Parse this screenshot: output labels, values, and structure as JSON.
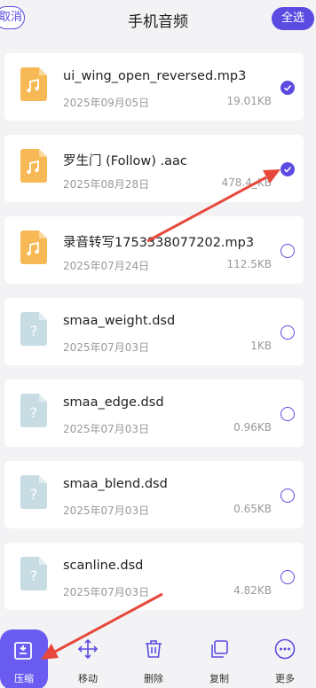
{
  "header": {
    "cancel_label": "取消",
    "title": "手机音频",
    "select_all_label": "全选"
  },
  "files": [
    {
      "name": "ui_wing_open_reversed.mp3",
      "date": "2025年09月05日",
      "size": "19.01KB",
      "type": "audio",
      "checked": true
    },
    {
      "name": "罗生门 (Follow) .aac",
      "date": "2025年08月28日",
      "size": "478.4_KB",
      "type": "audio",
      "checked": true
    },
    {
      "name": "录音转写1753338077202.mp3",
      "date": "2025年07月24日",
      "size": "112.5KB",
      "type": "audio",
      "checked": false
    },
    {
      "name": "smaa_weight.dsd",
      "date": "2025年07月03日",
      "size": "1KB",
      "type": "unknown",
      "checked": false
    },
    {
      "name": "smaa_edge.dsd",
      "date": "2025年07月03日",
      "size": "0.96KB",
      "type": "unknown",
      "checked": false
    },
    {
      "name": "smaa_blend.dsd",
      "date": "2025年07月03日",
      "size": "0.65KB",
      "type": "unknown",
      "checked": false
    },
    {
      "name": "scanline.dsd",
      "date": "2025年07月03日",
      "size": "4.82KB",
      "type": "unknown",
      "checked": false
    }
  ],
  "toolbar": {
    "compress_label": "压缩",
    "move_label": "移动",
    "delete_label": "删除",
    "copy_label": "复制",
    "more_label": "更多"
  },
  "colors": {
    "accent": "#5b4be0",
    "audio_icon": "#f7b955",
    "unknown_icon": "#c7dde3",
    "arrow": "#e8483b"
  }
}
